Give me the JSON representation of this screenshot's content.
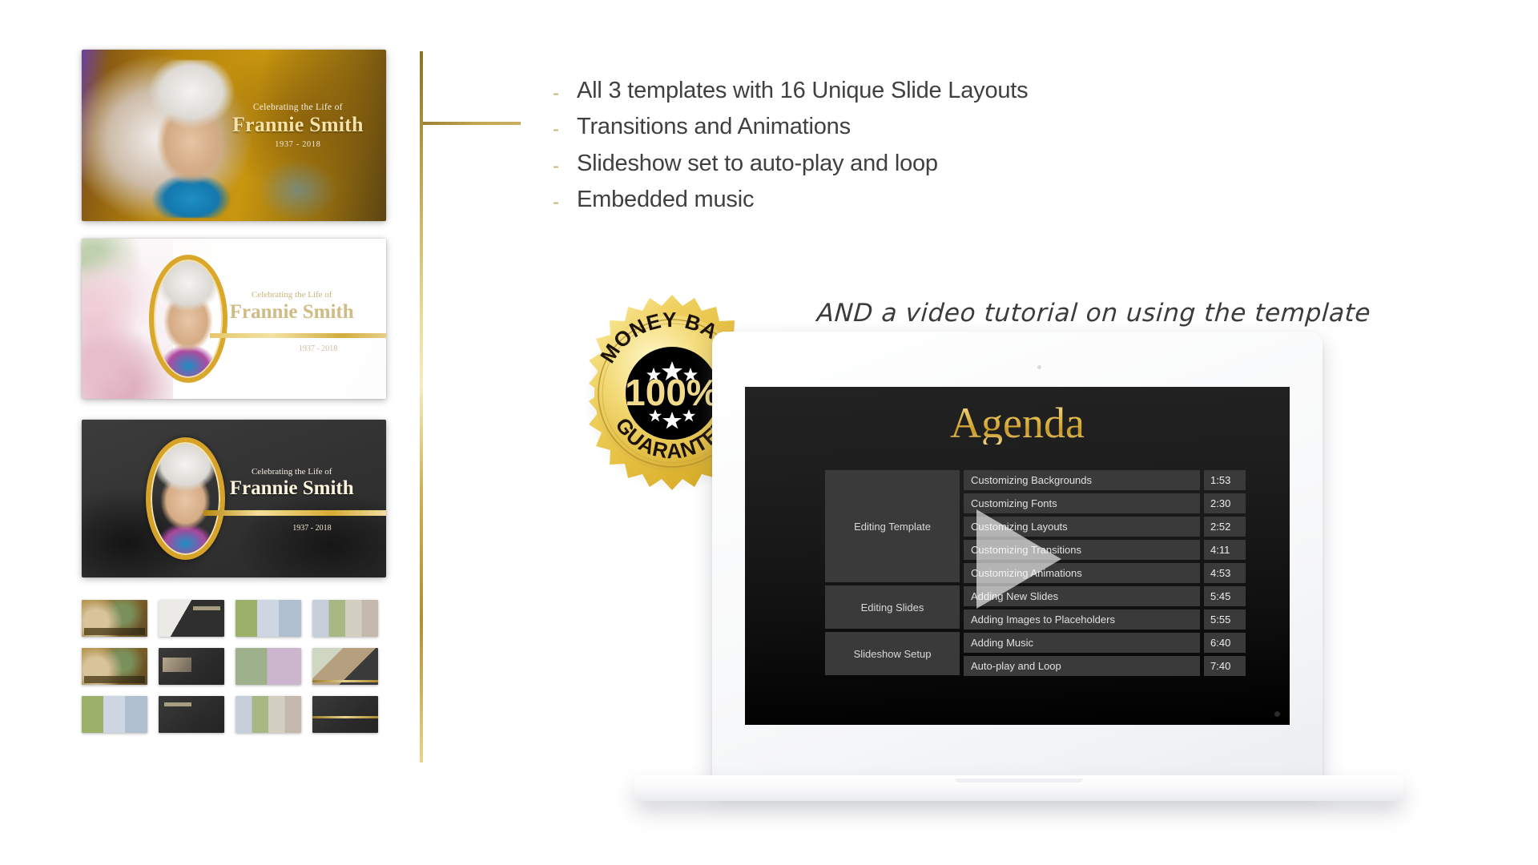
{
  "features": {
    "bullet_marker": "-",
    "items": [
      "All 3 templates with 16 Unique Slide Layouts",
      "Transitions and Animations",
      "Slideshow set to auto-play and loop",
      "Embedded music"
    ]
  },
  "tagline": "AND a video tutorial on using the template",
  "badge": {
    "top_text": "MONEY BACK",
    "bottom_text": "GUARANTEE",
    "percent": "100%",
    "gold_light": "#FDF0A8",
    "gold_mid": "#E8C547",
    "gold_dark": "#B8901F",
    "center_bg": "#000000"
  },
  "slides": [
    {
      "id": "slide-gold",
      "eyebrow": "Celebrating the Life of",
      "name": "Frannie Smith",
      "years": "1937 - 2018",
      "style": "gold-photo"
    },
    {
      "id": "slide-floral",
      "eyebrow": "Celebrating the Life of",
      "name": "Frannie Smith",
      "years": "1937 - 2018",
      "style": "light-floral"
    },
    {
      "id": "slide-dark",
      "eyebrow": "Celebrating the Life of",
      "name": "Frannie Smith",
      "years": "1937 - 2018",
      "style": "dark"
    }
  ],
  "thumbnails": [
    {
      "index": 1,
      "kind": "photo-warm-caption"
    },
    {
      "index": 2,
      "kind": "bw-portrait-dark"
    },
    {
      "index": 3,
      "kind": "collage-six"
    },
    {
      "index": 4,
      "kind": "collage-six-alt"
    },
    {
      "index": 5,
      "kind": "photo-dark-caption"
    },
    {
      "index": 6,
      "kind": "group-dark-text"
    },
    {
      "index": 7,
      "kind": "two-photo-outdoor"
    },
    {
      "index": 8,
      "kind": "collage-gold-frame"
    },
    {
      "index": 9,
      "kind": "collage-four"
    },
    {
      "index": 10,
      "kind": "dark-list-slide"
    },
    {
      "index": 11,
      "kind": "collage-four-alt"
    },
    {
      "index": 12,
      "kind": "dark-gold-bar-closing"
    }
  ],
  "video": {
    "screen_title": "Agenda",
    "play_icon": "play-triangle-icon",
    "agenda": {
      "categories": [
        {
          "label": "Editing Template",
          "rows": 5
        },
        {
          "label": "Editing Slides",
          "rows": 2
        },
        {
          "label": "Slideshow Setup",
          "rows": 2
        }
      ],
      "rows": [
        {
          "topic": "Customizing Backgrounds",
          "time": "1:53"
        },
        {
          "topic": "Customizing Fonts",
          "time": "2:30"
        },
        {
          "topic": "Customizing Layouts",
          "time": "2:52"
        },
        {
          "topic": "Customizing Transitions",
          "time": "4:11"
        },
        {
          "topic": "Customizing Animations",
          "time": "4:53"
        },
        {
          "topic": "Adding New Slides",
          "time": "5:45"
        },
        {
          "topic": "Adding Images to Placeholders",
          "time": "5:55"
        },
        {
          "topic": "Adding Music",
          "time": "6:40"
        },
        {
          "topic": "Auto-play and Loop",
          "time": "7:40"
        }
      ]
    }
  },
  "colors": {
    "gold_rule": "#C4A851",
    "text_dark": "#404040",
    "page_bg": "#FFFFFF"
  }
}
